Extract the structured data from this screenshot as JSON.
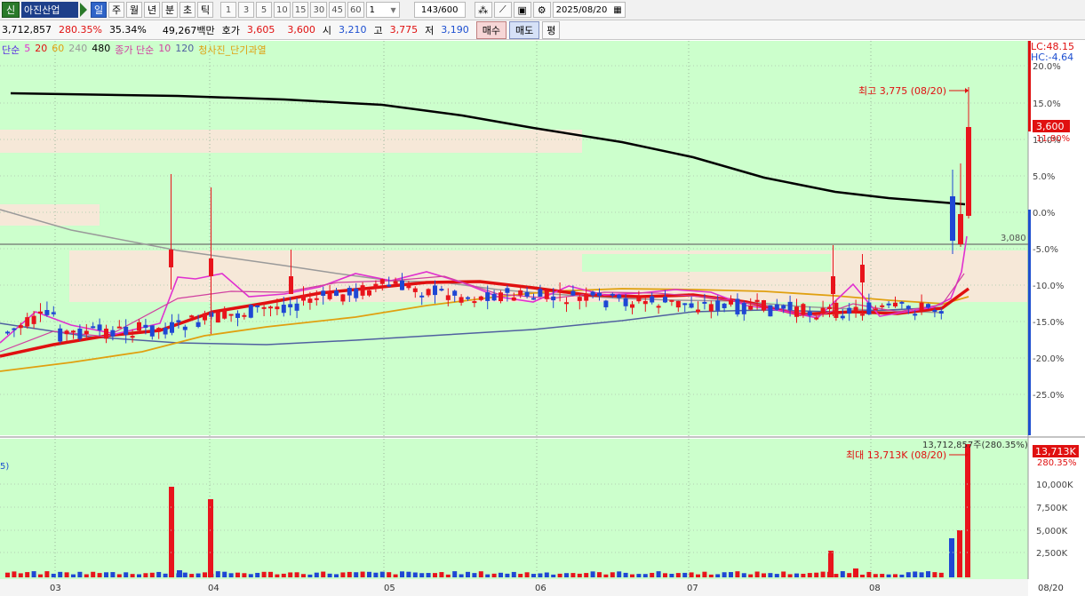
{
  "toolbar": {
    "badge": "신",
    "stock_name": "아진산업",
    "periods": [
      "일",
      "주",
      "월",
      "년",
      "분",
      "초",
      "틱"
    ],
    "active_period": "일",
    "numbers": [
      "1",
      "3",
      "5",
      "10",
      "15",
      "30",
      "45",
      "60"
    ],
    "combo_value": "1",
    "count": "143/600",
    "date": "2025/08/20"
  },
  "quote": {
    "volume": "3,712,857",
    "vol_ratio": "280.35%",
    "turnover": "35.34%",
    "amount": "49,267백만",
    "hoga_label": "호가",
    "ask": "3,605",
    "bid": "3,600",
    "open_label": "시",
    "open": "3,210",
    "high_label": "고",
    "high": "3,775",
    "low_label": "저",
    "low": "3,190",
    "buy_label": "매수",
    "sell_label": "매도",
    "flat_label": "평"
  },
  "legend": {
    "ma_prefix": "단순",
    "ma_values": [
      "5",
      "20",
      "60",
      "240",
      "480"
    ],
    "vol_prefix": "종가 단순",
    "vol_values": [
      "10",
      "120"
    ],
    "tail": "청사진_단기과열"
  },
  "right_labels": {
    "lc": "LC:48.15",
    "hc": "HC:-4.64",
    "price_tag": "3,600",
    "pct_tag": "11.80%",
    "ref_line": "3,080",
    "high_note": "최고 3,775 (08/20)",
    "vol_note": "최대 13,713K (08/20)",
    "vol_top": "13,712,857주(280.35%)",
    "vol_tag": "13,713K",
    "vol_pct_tag": "280.35%",
    "vol_left_mark": "5)"
  },
  "price_axis": [
    "20.0%",
    "15.0%",
    "10.0%",
    "5.0%",
    "0.0%",
    "-5.0%",
    "-10.0%",
    "-15.0%",
    "-20.0%",
    "-25.0%"
  ],
  "volume_axis": [
    "10,000K",
    "7,500K",
    "5,000K",
    "2,500K"
  ],
  "x_axis": [
    "03",
    "04",
    "05",
    "06",
    "07",
    "08",
    "08/20"
  ],
  "colors": {
    "up": "#e8141c",
    "down": "#1f47d4",
    "bg": "#ccffcc",
    "ma5": "#e030d0",
    "ma20": "#e01010",
    "ma60": "#e0a010",
    "ma240": "#9a9a9a",
    "ma480": "#000000"
  },
  "chart_data": {
    "type": "candlestick",
    "note_high": "최고 3,775 (08/20)",
    "last_close": 3600,
    "reference_price": 3080,
    "volume_last": 13712857
  }
}
